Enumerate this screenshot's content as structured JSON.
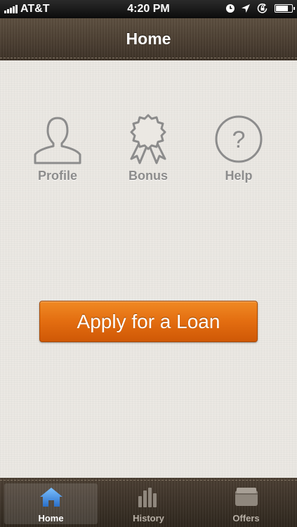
{
  "status_bar": {
    "carrier": "AT&T",
    "time": "4:20 PM",
    "battery_level": 0.85,
    "icons": [
      "signal-icon",
      "clock-icon",
      "location-icon",
      "rotation-lock-icon",
      "battery-icon"
    ]
  },
  "nav": {
    "title": "Home"
  },
  "menu": {
    "items": [
      {
        "label": "Profile",
        "icon": "person-icon"
      },
      {
        "label": "Bonus",
        "icon": "award-ribbon-icon"
      },
      {
        "label": "Help",
        "icon": "question-circle-icon"
      }
    ]
  },
  "apply_button": {
    "label": "Apply for a Loan"
  },
  "tab_bar": {
    "tabs": [
      {
        "label": "Home",
        "icon": "house-icon",
        "active": true
      },
      {
        "label": "History",
        "icon": "bar-chart-icon",
        "active": false
      },
      {
        "label": "Offers",
        "icon": "wallet-icon",
        "active": false
      }
    ]
  },
  "colors": {
    "accent_orange": "#e36d10",
    "nav_brown": "#4a3e32",
    "background": "#ebe8e3",
    "icon_gray": "#8c8c8c",
    "active_tab_blue": "#3a86d8"
  }
}
